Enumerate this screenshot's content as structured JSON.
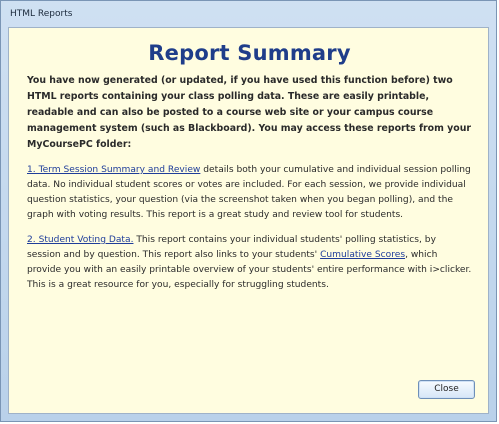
{
  "window": {
    "title": "HTML Reports"
  },
  "content": {
    "heading": "Report Summary",
    "intro": "You have now generated (or updated, if you have used this function before) two HTML reports containing your class polling data. These are easily printable, readable and can also be posted to a course web site or your campus course management system (such as Blackboard). You may access these reports from your MyCoursePC folder:",
    "section1": {
      "link_text": "1. Term Session Summary and Review",
      "body": " details both your cumulative and individual session polling data. No individual student scores or votes are included. For each session, we provide individual question statistics, your question (via the screenshot taken when you began polling), and the graph with voting results. This report is a great study and review tool for students."
    },
    "section2": {
      "link_text": "2. Student Voting Data.",
      "body_before": " This report contains your individual students' polling statistics, by session and by question. This report also links to your students' ",
      "inline_link": "Cumulative Scores",
      "body_after": ", which provide you with an easily printable overview of your students' entire performance with i>clicker. This is a great resource for you, especially for struggling students."
    },
    "close_label": "Close"
  }
}
